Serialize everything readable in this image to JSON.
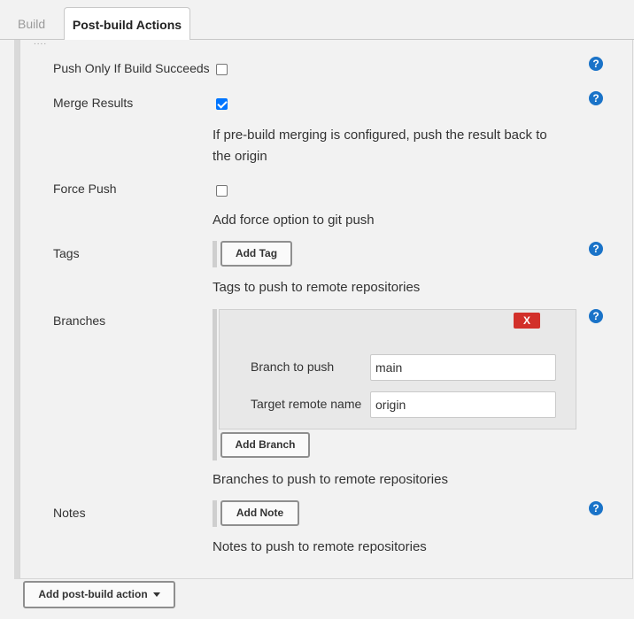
{
  "tabs": {
    "build": "Build",
    "post_build": "Post-build Actions"
  },
  "fields": {
    "push_only": {
      "label": "Push Only If Build Succeeds",
      "checked": false
    },
    "merge_results": {
      "label": "Merge Results",
      "checked": true,
      "help_line1": "If pre-build merging is configured, push the result back to",
      "help_line2": "the origin"
    },
    "force_push": {
      "label": "Force Push",
      "checked": false,
      "help": "Add force option to git push"
    },
    "tags": {
      "label": "Tags",
      "add_button": "Add Tag",
      "help": "Tags to push to remote repositories"
    },
    "branches": {
      "label": "Branches",
      "delete_button": "X",
      "branch_to_push_label": "Branch to push",
      "branch_to_push_value": "main",
      "target_remote_label": "Target remote name",
      "target_remote_value": "origin",
      "add_button": "Add Branch",
      "help": "Branches to push to remote repositories"
    },
    "notes": {
      "label": "Notes",
      "add_button": "Add Note",
      "help": "Notes to push to remote repositories"
    }
  },
  "footer": {
    "add_post_build": "Add post-build action"
  },
  "icons": {
    "help": "help-icon",
    "caret": "caret-down-icon",
    "grip": "drag-handle-icon"
  },
  "colors": {
    "help_blue": "#1a73c8",
    "delete_red": "#d2302a",
    "checkbox_blue": "#0075ff"
  }
}
